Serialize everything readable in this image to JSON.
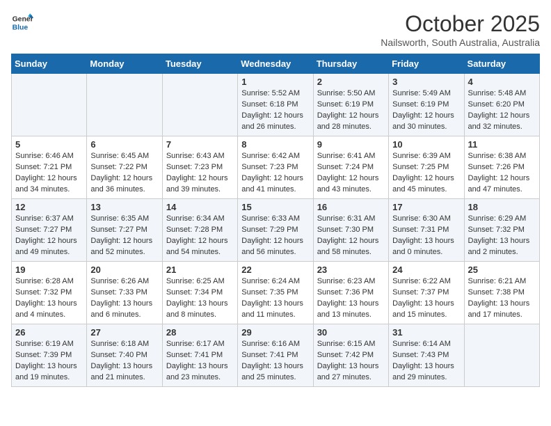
{
  "header": {
    "logo_line1": "General",
    "logo_line2": "Blue",
    "month": "October 2025",
    "location": "Nailsworth, South Australia, Australia"
  },
  "days_of_week": [
    "Sunday",
    "Monday",
    "Tuesday",
    "Wednesday",
    "Thursday",
    "Friday",
    "Saturday"
  ],
  "weeks": [
    [
      {
        "day": "",
        "info": ""
      },
      {
        "day": "",
        "info": ""
      },
      {
        "day": "",
        "info": ""
      },
      {
        "day": "1",
        "info": "Sunrise: 5:52 AM\nSunset: 6:18 PM\nDaylight: 12 hours\nand 26 minutes."
      },
      {
        "day": "2",
        "info": "Sunrise: 5:50 AM\nSunset: 6:19 PM\nDaylight: 12 hours\nand 28 minutes."
      },
      {
        "day": "3",
        "info": "Sunrise: 5:49 AM\nSunset: 6:19 PM\nDaylight: 12 hours\nand 30 minutes."
      },
      {
        "day": "4",
        "info": "Sunrise: 5:48 AM\nSunset: 6:20 PM\nDaylight: 12 hours\nand 32 minutes."
      }
    ],
    [
      {
        "day": "5",
        "info": "Sunrise: 6:46 AM\nSunset: 7:21 PM\nDaylight: 12 hours\nand 34 minutes."
      },
      {
        "day": "6",
        "info": "Sunrise: 6:45 AM\nSunset: 7:22 PM\nDaylight: 12 hours\nand 36 minutes."
      },
      {
        "day": "7",
        "info": "Sunrise: 6:43 AM\nSunset: 7:23 PM\nDaylight: 12 hours\nand 39 minutes."
      },
      {
        "day": "8",
        "info": "Sunrise: 6:42 AM\nSunset: 7:23 PM\nDaylight: 12 hours\nand 41 minutes."
      },
      {
        "day": "9",
        "info": "Sunrise: 6:41 AM\nSunset: 7:24 PM\nDaylight: 12 hours\nand 43 minutes."
      },
      {
        "day": "10",
        "info": "Sunrise: 6:39 AM\nSunset: 7:25 PM\nDaylight: 12 hours\nand 45 minutes."
      },
      {
        "day": "11",
        "info": "Sunrise: 6:38 AM\nSunset: 7:26 PM\nDaylight: 12 hours\nand 47 minutes."
      }
    ],
    [
      {
        "day": "12",
        "info": "Sunrise: 6:37 AM\nSunset: 7:27 PM\nDaylight: 12 hours\nand 49 minutes."
      },
      {
        "day": "13",
        "info": "Sunrise: 6:35 AM\nSunset: 7:27 PM\nDaylight: 12 hours\nand 52 minutes."
      },
      {
        "day": "14",
        "info": "Sunrise: 6:34 AM\nSunset: 7:28 PM\nDaylight: 12 hours\nand 54 minutes."
      },
      {
        "day": "15",
        "info": "Sunrise: 6:33 AM\nSunset: 7:29 PM\nDaylight: 12 hours\nand 56 minutes."
      },
      {
        "day": "16",
        "info": "Sunrise: 6:31 AM\nSunset: 7:30 PM\nDaylight: 12 hours\nand 58 minutes."
      },
      {
        "day": "17",
        "info": "Sunrise: 6:30 AM\nSunset: 7:31 PM\nDaylight: 13 hours\nand 0 minutes."
      },
      {
        "day": "18",
        "info": "Sunrise: 6:29 AM\nSunset: 7:32 PM\nDaylight: 13 hours\nand 2 minutes."
      }
    ],
    [
      {
        "day": "19",
        "info": "Sunrise: 6:28 AM\nSunset: 7:32 PM\nDaylight: 13 hours\nand 4 minutes."
      },
      {
        "day": "20",
        "info": "Sunrise: 6:26 AM\nSunset: 7:33 PM\nDaylight: 13 hours\nand 6 minutes."
      },
      {
        "day": "21",
        "info": "Sunrise: 6:25 AM\nSunset: 7:34 PM\nDaylight: 13 hours\nand 8 minutes."
      },
      {
        "day": "22",
        "info": "Sunrise: 6:24 AM\nSunset: 7:35 PM\nDaylight: 13 hours\nand 11 minutes."
      },
      {
        "day": "23",
        "info": "Sunrise: 6:23 AM\nSunset: 7:36 PM\nDaylight: 13 hours\nand 13 minutes."
      },
      {
        "day": "24",
        "info": "Sunrise: 6:22 AM\nSunset: 7:37 PM\nDaylight: 13 hours\nand 15 minutes."
      },
      {
        "day": "25",
        "info": "Sunrise: 6:21 AM\nSunset: 7:38 PM\nDaylight: 13 hours\nand 17 minutes."
      }
    ],
    [
      {
        "day": "26",
        "info": "Sunrise: 6:19 AM\nSunset: 7:39 PM\nDaylight: 13 hours\nand 19 minutes."
      },
      {
        "day": "27",
        "info": "Sunrise: 6:18 AM\nSunset: 7:40 PM\nDaylight: 13 hours\nand 21 minutes."
      },
      {
        "day": "28",
        "info": "Sunrise: 6:17 AM\nSunset: 7:41 PM\nDaylight: 13 hours\nand 23 minutes."
      },
      {
        "day": "29",
        "info": "Sunrise: 6:16 AM\nSunset: 7:41 PM\nDaylight: 13 hours\nand 25 minutes."
      },
      {
        "day": "30",
        "info": "Sunrise: 6:15 AM\nSunset: 7:42 PM\nDaylight: 13 hours\nand 27 minutes."
      },
      {
        "day": "31",
        "info": "Sunrise: 6:14 AM\nSunset: 7:43 PM\nDaylight: 13 hours\nand 29 minutes."
      },
      {
        "day": "",
        "info": ""
      }
    ]
  ]
}
